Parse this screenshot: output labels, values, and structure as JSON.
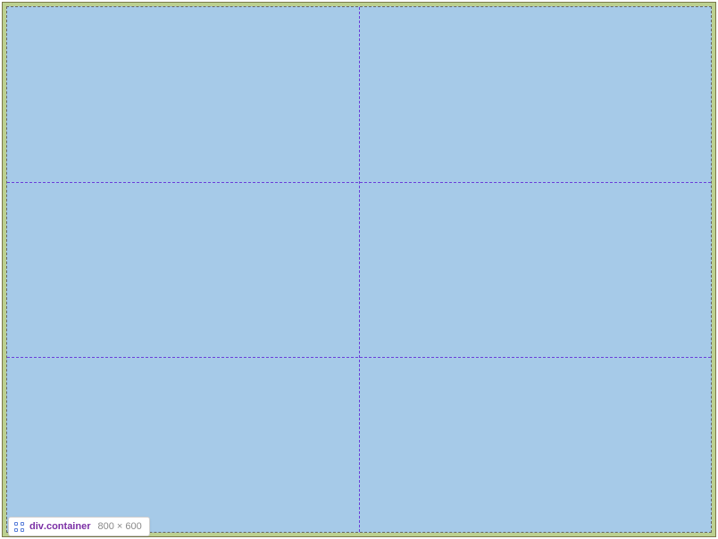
{
  "inspector": {
    "tag": "div",
    "class": "container",
    "dimensions": "800 × 600"
  }
}
